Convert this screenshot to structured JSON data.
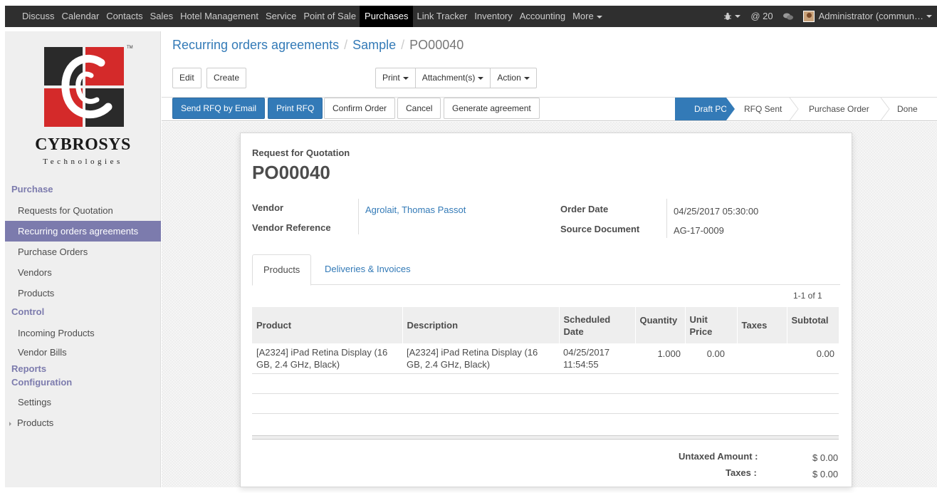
{
  "topbar": {
    "menu": [
      {
        "label": "Discuss",
        "active": false
      },
      {
        "label": "Calendar",
        "active": false
      },
      {
        "label": "Contacts",
        "active": false
      },
      {
        "label": "Sales",
        "active": false
      },
      {
        "label": "Hotel Management",
        "active": false
      },
      {
        "label": "Service",
        "active": false
      },
      {
        "label": "Point of Sale",
        "active": false
      },
      {
        "label": "Purchases",
        "active": true
      },
      {
        "label": "Link Tracker",
        "active": false
      },
      {
        "label": "Inventory",
        "active": false
      },
      {
        "label": "Accounting",
        "active": false
      }
    ],
    "more_label": "More",
    "bug_icon": "bug-icon",
    "mention_count": "@ 20",
    "chat_icon": "chat-bubbles-icon",
    "user_label": "Administrator (commun…"
  },
  "sidebar": {
    "logo": {
      "name": "CYBROSYS",
      "sub": "Technologies",
      "tm": "TM"
    },
    "sections": [
      {
        "title": "Purchase",
        "items": [
          {
            "label": "Requests for Quotation",
            "active": false
          },
          {
            "label": "Recurring orders agreements",
            "active": true
          },
          {
            "label": "Purchase Orders",
            "active": false
          },
          {
            "label": "Vendors",
            "active": false
          },
          {
            "label": "Products",
            "active": false
          }
        ]
      },
      {
        "title": "Control",
        "items": [
          {
            "label": "Incoming Products",
            "active": false
          },
          {
            "label": "Vendor Bills",
            "active": false
          }
        ]
      },
      {
        "title": "Reports",
        "items": []
      },
      {
        "title": "Configuration",
        "items": [
          {
            "label": "Settings",
            "active": false
          },
          {
            "label": "Products",
            "active": false,
            "expandable": true
          }
        ]
      }
    ]
  },
  "breadcrumb": {
    "root": "Recurring orders agreements",
    "middle": "Sample",
    "current": "PO00040"
  },
  "control": {
    "edit_label": "Edit",
    "create_label": "Create",
    "print_label": "Print",
    "attachments_label": "Attachment(s)",
    "action_label": "Action"
  },
  "statusbar": {
    "buttons": [
      "Send RFQ by Email",
      "Print RFQ",
      "Confirm Order",
      "Cancel",
      "Generate agreement"
    ],
    "stages": [
      "Draft PO",
      "RFQ Sent",
      "Purchase Order",
      "Done"
    ],
    "active_stage": "Draft PO"
  },
  "form": {
    "doc_type": "Request for Quotation",
    "name": "PO00040",
    "vendor_label": "Vendor",
    "vendor": "Agrolait, Thomas Passot",
    "vendor_ref_label": "Vendor Reference",
    "vendor_ref": "",
    "order_date_label": "Order Date",
    "order_date": "04/25/2017 05:30:00",
    "source_doc_label": "Source Document",
    "source_doc": "AG-17-0009"
  },
  "tabs": [
    {
      "label": "Products",
      "active": true
    },
    {
      "label": "Deliveries & Invoices",
      "active": false
    }
  ],
  "pager": "1-1 of 1",
  "table": {
    "headers": {
      "product": "Product",
      "description": "Description",
      "scheduled1": "Scheduled",
      "scheduled2": "Date",
      "quantity": "Quantity",
      "unit1": "Unit",
      "unit2": "Price",
      "taxes": "Taxes",
      "subtotal": "Subtotal"
    },
    "rows": [
      {
        "product1": "[A2324] iPad Retina Display (16",
        "product2": "GB, 2.4 GHz, Black)",
        "description1": "[A2324] iPad Retina Display (16",
        "description2": "GB, 2.4 GHz, Black)",
        "date1": "04/25/2017",
        "date2": "11:54:55",
        "quantity": "1.000",
        "unit_price": "0.00",
        "taxes": "",
        "subtotal": "0.00"
      }
    ]
  },
  "totals": {
    "untaxed_label": "Untaxed Amount :",
    "untaxed": "$ 0.00",
    "taxes_label": "Taxes :",
    "taxes": "$ 0.00"
  },
  "colors": {
    "primary": "#337ab7",
    "sidebar_accent": "#7c7bad",
    "logo_red": "#d42a2a",
    "logo_dark": "#2a2a2a"
  }
}
